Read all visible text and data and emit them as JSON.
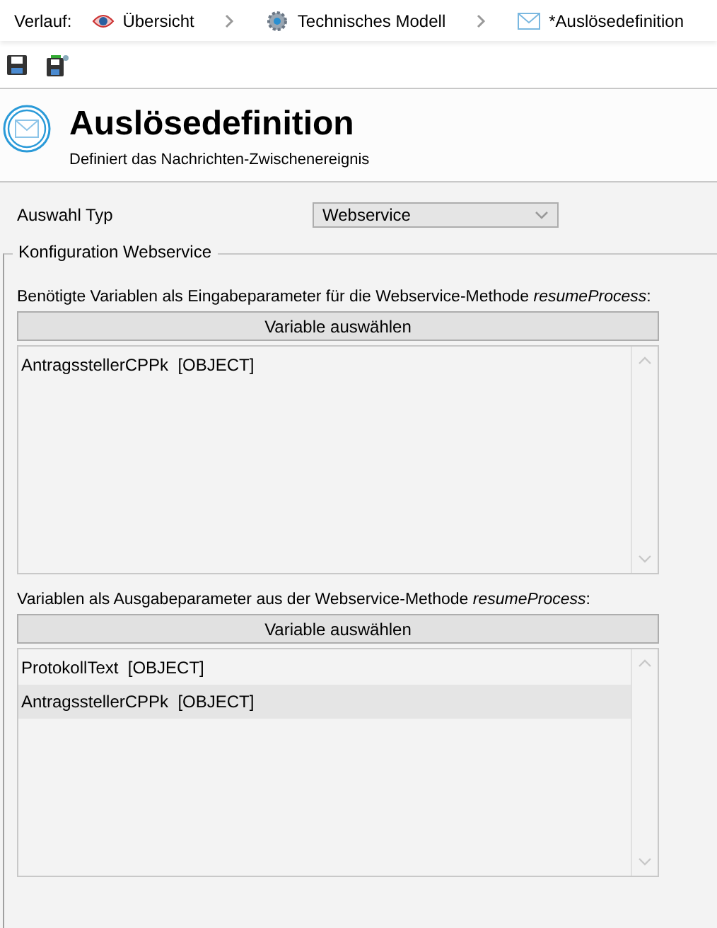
{
  "breadcrumb": {
    "label": "Verlauf:",
    "items": [
      {
        "text": "Übersicht",
        "kind": "eye"
      },
      {
        "text": "Technisches Modell",
        "kind": "gear"
      },
      {
        "text": "*Auslösedefinition",
        "kind": "mail"
      }
    ]
  },
  "toolbar": [
    {
      "kind": "save"
    },
    {
      "kind": "save-as"
    }
  ],
  "header": {
    "title": "Auslösedefinition",
    "subtitle": "Definiert das Nachrichten-Zwischenereignis"
  },
  "type_select": {
    "label": "Auswahl Typ",
    "value": "Webservice"
  },
  "group": {
    "title": "Konfiguration Webservice",
    "sections": [
      {
        "description": "Benötigte Variablen als Eingabeparameter für die Webservice-Methode *resumeProcess*:",
        "button": "Variable auswählen",
        "items": [
          {
            "text": "AntragsstellerCPPk  [OBJECT]",
            "selected": false
          }
        ]
      },
      {
        "description": "Variablen als Ausgabeparameter aus der Webservice-Methode *resumeProcess*:",
        "button": "Variable auswählen",
        "items": [
          {
            "text": "ProtokollText  [OBJECT]",
            "selected": false
          },
          {
            "text": "AntragsstellerCPPk  [OBJECT]",
            "selected": true
          }
        ]
      }
    ]
  }
}
